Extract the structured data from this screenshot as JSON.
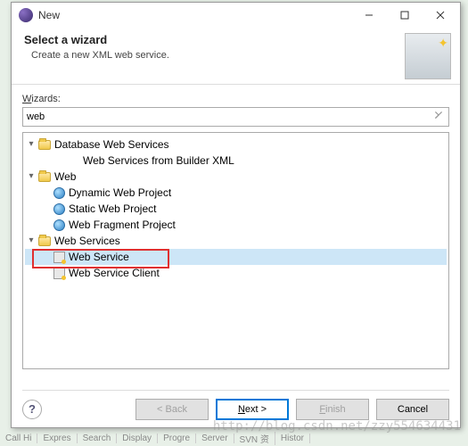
{
  "window": {
    "title": "New"
  },
  "header": {
    "title": "Select a wizard",
    "subtitle": "Create a new XML web service."
  },
  "filter": {
    "label_char": "W",
    "label_rest": "izards:",
    "value": "web"
  },
  "tree": {
    "n0": "Database Web Services",
    "n0_0": "Web Services from Builder XML",
    "n1": "Web",
    "n1_0": "Dynamic Web Project",
    "n1_1": "Static Web Project",
    "n1_2": "Web Fragment Project",
    "n2": "Web Services",
    "n2_0": "Web Service",
    "n2_1": "Web Service Client"
  },
  "buttons": {
    "back": "< Back",
    "next_u": "N",
    "next_rest": "ext >",
    "finish_u": "F",
    "finish_rest": "inish",
    "cancel": "Cancel",
    "help": "?"
  },
  "bg_tabs": [
    "Call Hi",
    "Expres",
    "Search",
    "Display",
    "Progre",
    "Server",
    "SVN 资",
    "Histor"
  ],
  "watermark": "http://blog.csdn.net/zzy554634431"
}
